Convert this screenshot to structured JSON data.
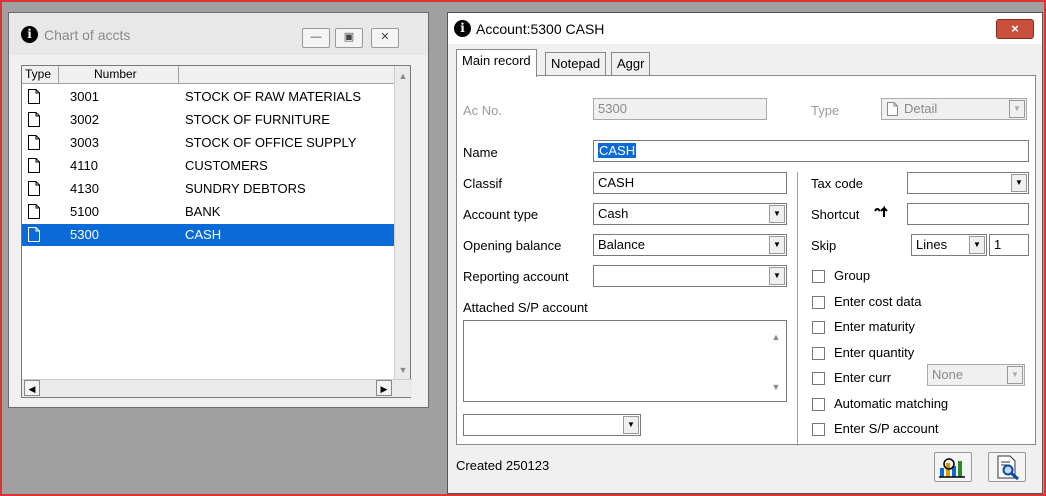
{
  "chart_window": {
    "title": "Chart of accts",
    "columns": [
      "Type",
      "Number"
    ],
    "rows": [
      {
        "number": "3001",
        "name": "STOCK OF RAW MATERIALS"
      },
      {
        "number": "3002",
        "name": "STOCK OF FURNITURE"
      },
      {
        "number": "3003",
        "name": "STOCK OF OFFICE SUPPLY"
      },
      {
        "number": "4110",
        "name": "CUSTOMERS"
      },
      {
        "number": "4130",
        "name": "SUNDRY DEBTORS"
      },
      {
        "number": "5100",
        "name": "BANK"
      },
      {
        "number": "5300",
        "name": "CASH"
      }
    ],
    "selected_index": 6
  },
  "account_window": {
    "title": "Account:5300 CASH",
    "close_label": "×",
    "tabs": [
      "Main record",
      "Notepad",
      "Aggr"
    ],
    "ac_no_label": "Ac No.",
    "ac_no_value": "5300",
    "type_label": "Type",
    "type_value": "Detail",
    "name_label": "Name",
    "name_value": "CASH",
    "classif_label": "Classif",
    "classif_value": "CASH",
    "account_type_label": "Account type",
    "account_type_value": "Cash",
    "opening_balance_label": "Opening balance",
    "opening_balance_value": "Balance",
    "reporting_account_label": "Reporting account",
    "reporting_account_value": "",
    "attached_label": "Attached S/P account",
    "tax_code_label": "Tax code",
    "tax_code_value": "",
    "shortcut_label": "Shortcut",
    "shortcut_value": "",
    "skip_label": "Skip",
    "skip_unit": "Lines",
    "skip_value": "1",
    "checkboxes": [
      "Group",
      "Enter cost data",
      "Enter maturity",
      "Enter quantity",
      "Enter curr",
      "Automatic matching",
      "Enter S/P account"
    ],
    "curr_value": "None",
    "status": "Created 250123"
  },
  "colors": {
    "selection": "#0a6ad8",
    "close": "#c9503c",
    "frame": "#d33333"
  }
}
